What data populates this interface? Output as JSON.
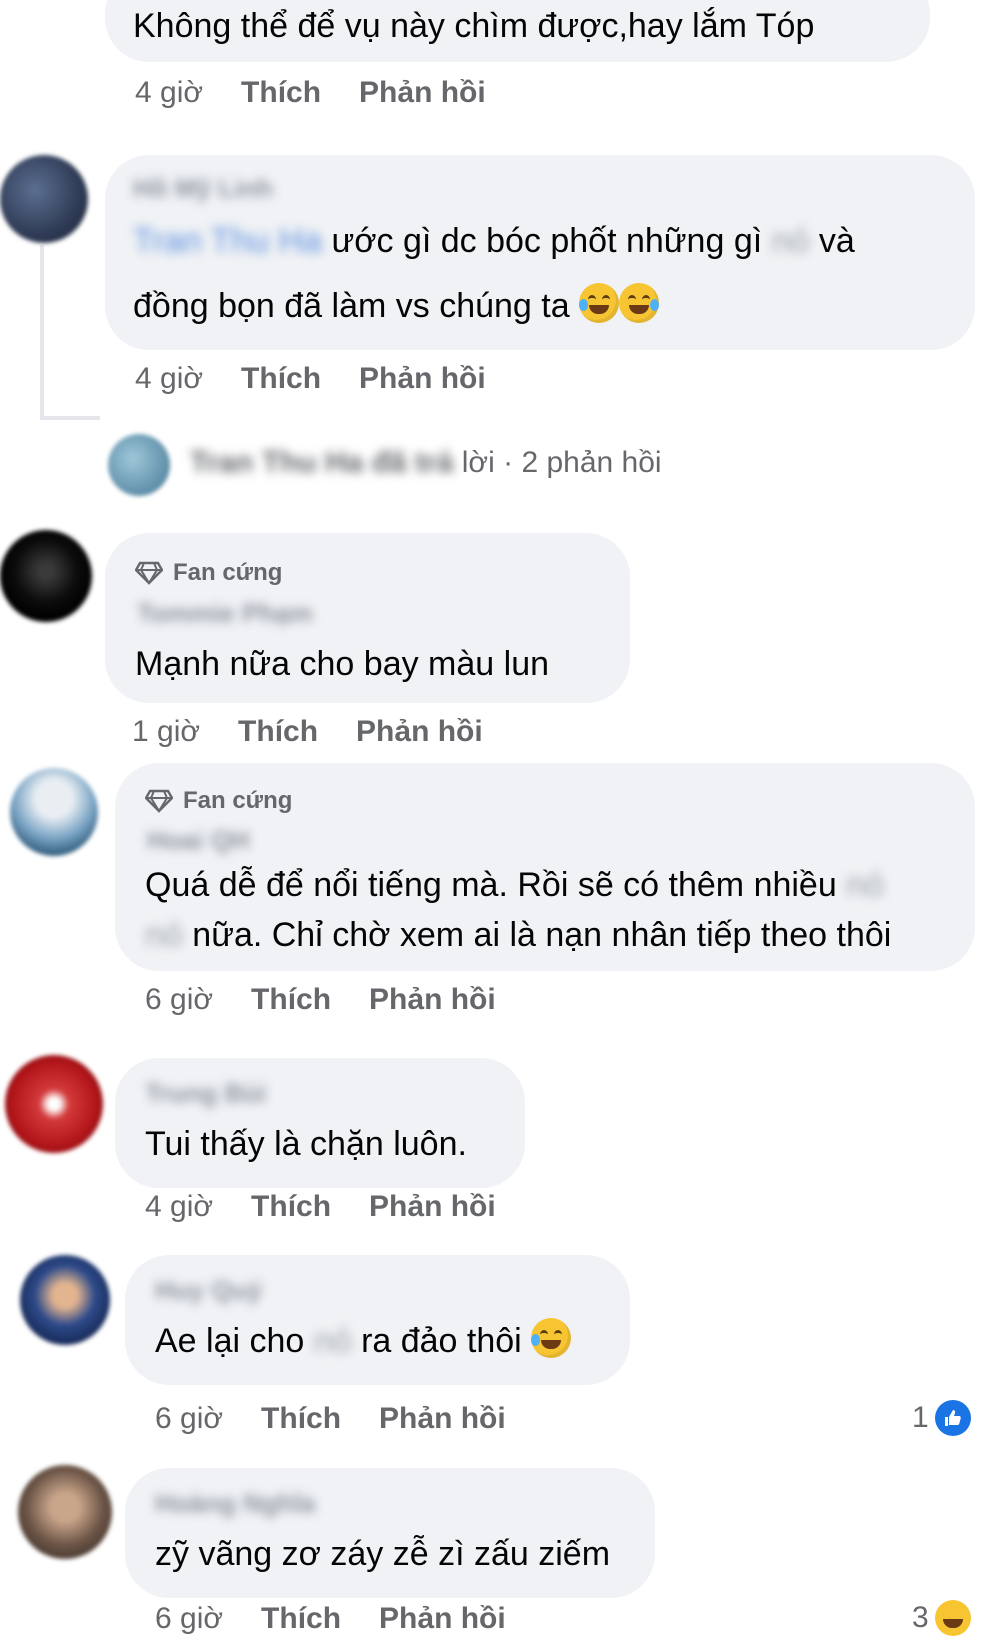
{
  "comments": [
    {
      "text": "Không thể để vụ này chìm được,hay lắm Tóp",
      "time": "4 giờ",
      "like": "Thích",
      "reply": "Phản hồi"
    },
    {
      "author": "Hồ Mỹ Linh",
      "mention": "Tran Thu Ha",
      "text_a": "ước gì dc bóc phốt những gì",
      "hidden_a": "nó",
      "text_b": "và",
      "text_c": "đồng bọn đã làm vs chúng ta",
      "time": "4 giờ",
      "like": "Thích",
      "reply": "Phản hồi"
    },
    {
      "badge": "Fan cứng",
      "author": "Tommie Phạm",
      "text": "Mạnh nữa cho bay màu lun",
      "time": "1 giờ",
      "like": "Thích",
      "reply": "Phản hồi"
    },
    {
      "badge": "Fan cứng",
      "author": "Hoai QH",
      "text_a": "Quá dễ để nổi tiếng mà. Rồi sẽ có thêm nhiều",
      "hidden_a": "nó",
      "hidden_b": "nó",
      "text_b": "nữa. Chỉ chờ xem ai là nạn nhân tiếp theo thôi",
      "time": "6 giờ",
      "like": "Thích",
      "reply": "Phản hồi"
    },
    {
      "author": "Trung Bùi",
      "text": "Tui thấy là chặn luôn.",
      "time": "4 giờ",
      "like": "Thích",
      "reply": "Phản hồi"
    },
    {
      "author": "Huy Quý",
      "text_a": "Ae lại cho",
      "hidden_a": "nó",
      "text_b": "ra đảo thôi",
      "time": "6 giờ",
      "like": "Thích",
      "reply": "Phản hồi",
      "reaction_count": "1"
    },
    {
      "author": "Hoàng Nghĩa",
      "text": "zỹ vãng zơ záy zễ zì zấu ziếm",
      "time": "6 giờ",
      "like": "Thích",
      "reply": "Phản hồi",
      "reaction_count": "3"
    }
  ],
  "replies_row": {
    "name_blurred": "Tran Thu Ha đã trả",
    "suffix": "lời",
    "sep": "·",
    "count": "2 phản hồi"
  },
  "colors": {
    "bubble": "#f0f2f5",
    "meta": "#65676b",
    "mention": "#5b8fe0",
    "like_blue": "#1b74e4",
    "haha_yellow": "#f7c532"
  },
  "icons": {
    "badge": "diamond-icon",
    "like": "like-reaction-icon",
    "haha": "haha-reaction-icon",
    "emoji": "tears-of-joy-emoji"
  }
}
